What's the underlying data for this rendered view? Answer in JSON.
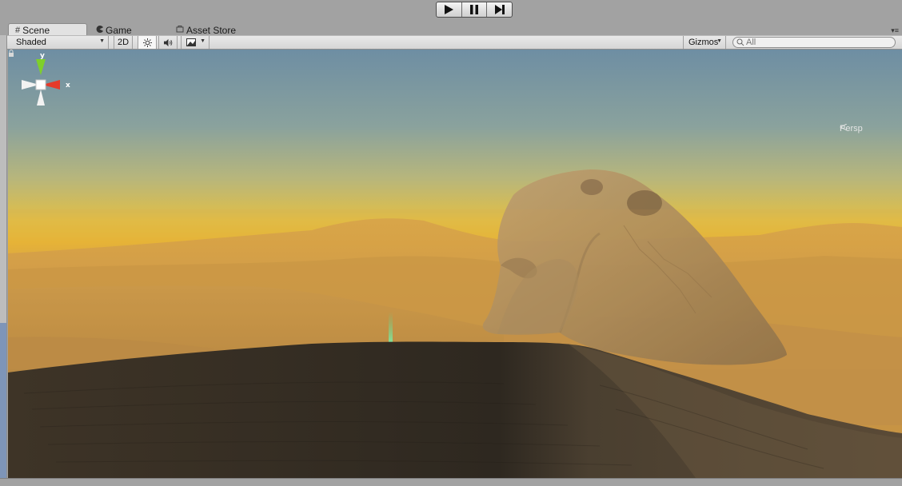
{
  "playbar": {
    "buttons": [
      {
        "name": "play",
        "icon": "play-icon"
      },
      {
        "name": "pause",
        "icon": "pause-icon"
      },
      {
        "name": "step",
        "icon": "step-icon"
      }
    ]
  },
  "tabs": [
    {
      "label": "Scene",
      "icon": "scene-grid-icon",
      "active": true
    },
    {
      "label": "Game",
      "icon": "game-pacman-icon",
      "active": false
    },
    {
      "label": "Asset Store",
      "icon": "store-bag-icon",
      "active": false
    }
  ],
  "toolbar": {
    "draw_mode": "Shaded",
    "mode_2d": "2D",
    "lighting_icon": "sun-icon",
    "audio_icon": "speaker-icon",
    "effects_icon": "image-icon",
    "gizmos_label": "Gizmos",
    "search_placeholder": "All"
  },
  "scene_gizmo": {
    "y_label": "y",
    "x_label": "x",
    "projection_label": "Persp",
    "colors": {
      "y": "#7fcf2a",
      "x": "#e53a2a",
      "neutral": "#ffffff"
    }
  },
  "colors": {
    "sky_top": "#6f8fa2",
    "horizon": "#e6b93b",
    "dune_far": "#c79a47",
    "dune_near": "#3a3024",
    "rock": "#a88a5c"
  }
}
